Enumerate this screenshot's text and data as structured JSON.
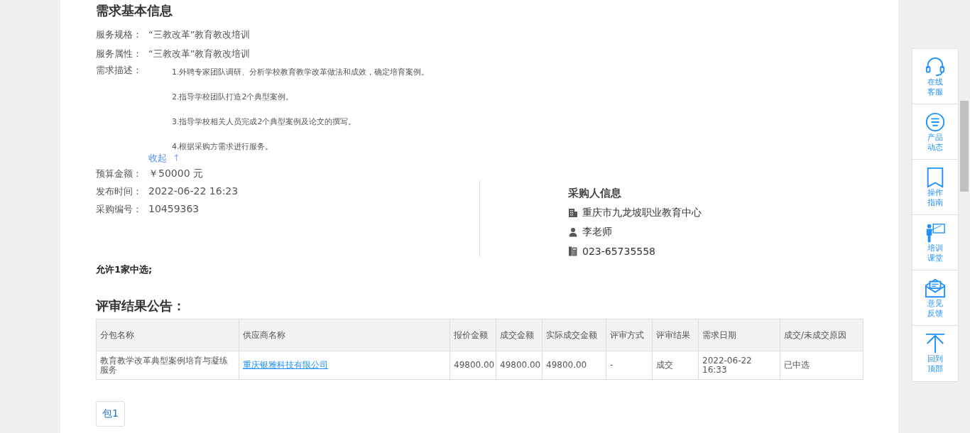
{
  "section_title": "需求基本信息",
  "info_rows": [
    {
      "label": "服务规格：",
      "value": "“三教改革”教育教改培训"
    },
    {
      "label": "服务属性：",
      "value": "“三教改革”教育教改培训"
    }
  ],
  "description": {
    "label": "需求描述：",
    "items": [
      "1.外聘专家团队调研、分析学校教育教学改革做法和成效，确定培育案例。",
      "2.指导学校团队打造2个典型案例。",
      "3.指导学校相关人员完成2个典型案例及论文的撰写。",
      "4.根据采购方需求进行服务。"
    ],
    "collapse_link": "收起",
    "collapse_arrow": "↑"
  },
  "detail_rows": [
    {
      "label": "预算金额：",
      "value": "￥50000 元"
    },
    {
      "label": "发布时间：",
      "value": "2022-06-22 16:23"
    },
    {
      "label": "采购编号：",
      "value": "10459363"
    }
  ],
  "buyer": {
    "title": "采购人信息",
    "items": [
      {
        "kind": "org",
        "text": "重庆市九龙坡职业教育中心"
      },
      {
        "kind": "person",
        "text": "李老师"
      },
      {
        "kind": "phone",
        "text": "023-65735558"
      }
    ]
  },
  "winner_note": "允许1家中选;",
  "results_title": "评审结果公告：",
  "table": {
    "columns": [
      "分包名称",
      "供应商名称",
      "报价金额",
      "成交金额",
      "实际成交金额",
      "评审方式",
      "评审结果",
      "需求日期",
      "成交/未成交原因"
    ],
    "rows": [
      [
        "教育教学改革典型案例培育与凝练服务",
        "重庆银雅科技有限公司",
        "49800.00",
        "49800.00",
        "49800.00",
        "-",
        "成交",
        "2022-06-22 16:33",
        "已中选"
      ]
    ]
  },
  "package_tabs": [
    {
      "label": "包1",
      "selected": true
    }
  ],
  "side_toolbar": [
    {
      "kind": "headset",
      "label": "在线客服"
    },
    {
      "kind": "news",
      "label": "产品动态"
    },
    {
      "kind": "bookmark",
      "label": "操作指南"
    },
    {
      "kind": "teacher",
      "label": "培训课堂"
    },
    {
      "kind": "mail",
      "label": "意见反馈"
    },
    {
      "kind": "top",
      "label": "回到顶部"
    }
  ]
}
